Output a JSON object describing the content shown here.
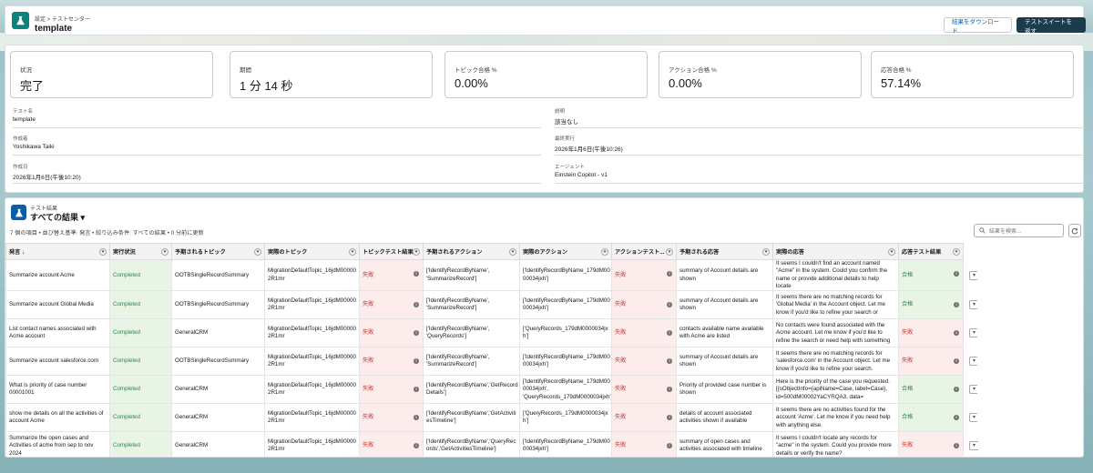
{
  "header": {
    "breadcrumb": "設定 > テストセンター",
    "title": "template",
    "download_label": "結果をダウンロード",
    "back_label": "テストスイートを返す"
  },
  "cards": [
    {
      "label": "状況",
      "value": "完了"
    },
    {
      "label": "期間",
      "value": "1 分 14 秒"
    },
    {
      "label": "トピック合格 %",
      "value": "0.00%"
    },
    {
      "label": "アクション合格 %",
      "value": "0.00%"
    },
    {
      "label": "応答合格 %",
      "value": "57.14%"
    }
  ],
  "details": {
    "test_name_label": "テスト名",
    "test_name": "template",
    "desc_label": "説明",
    "desc": "該当なし",
    "creator_label": "作成者",
    "creator": "Yoshikawa Taiki",
    "last_run_label": "最終実行",
    "last_run": "2026年1月6日(午後10:26)",
    "created_label": "作成日",
    "created": "2026年1月6日(午後10:20)",
    "agent_label": "エージェント",
    "agent": "Einstein Copilot - v1"
  },
  "results": {
    "subtitle": "テスト結果",
    "title": "すべての結果 ▾",
    "meta": "7 個の項目 • 並び替え基準: 発言 • 絞り込み条件: すべての結果 • 0 分前に更新",
    "search_placeholder": "結果を検索...",
    "columns": [
      "発言 ↓",
      "実行状況",
      "予期されるトピック",
      "実際のトピック",
      "トピックテスト結果",
      "予期されるアクション",
      "実際のアクション",
      "アクションテスト...",
      "予期される応答",
      "実際の応答",
      "応答テスト結果"
    ],
    "rows": [
      {
        "utterance": "Summarize account Acme",
        "status": "Completed",
        "exp_topic": "OOTBSingleRecordSummary",
        "act_topic": "MigrationDefaultTopic_16jdM00000 2R1mr",
        "topic_result": "失敗",
        "exp_action": "['IdentifyRecordByName', 'SummarizeRecord']",
        "act_action": "['IdentifyRecordByName_179dM00 00034jxh']",
        "action_result": "失敗",
        "exp_resp": "summary of Account details are shown",
        "act_resp": "It seems I couldn't find an account named \"Acme\" in the system. Could you confirm the name or provide additional details to help locate",
        "resp_result": "合格"
      },
      {
        "utterance": "Summarize account Global Media",
        "status": "Completed",
        "exp_topic": "OOTBSingleRecordSummary",
        "act_topic": "MigrationDefaultTopic_16jdM00000 2R1mr",
        "topic_result": "失敗",
        "exp_action": "['IdentifyRecordByName', 'SummarizeRecord']",
        "act_action": "['IdentifyRecordByName_179dM00 00034jxh']",
        "action_result": "失敗",
        "exp_resp": "summary of Account details are shown",
        "act_resp": "It seems there are no matching records for 'Global Media' in the Account object. Let me know if you'd like to refine your search or",
        "resp_result": "合格"
      },
      {
        "utterance": "List contact names associated with Acme account",
        "status": "Completed",
        "exp_topic": "GeneralCRM",
        "act_topic": "MigrationDefaultTopic_16jdM00000 2R1mr",
        "topic_result": "失敗",
        "exp_action": "['IdentifyRecordByName', 'QueryRecords']",
        "act_action": "['QueryRecords_179dM0000034jx h']",
        "action_result": "失敗",
        "exp_resp": "contacts available name available with Acme are listed",
        "act_resp": "No contacts were found associated with the Acme account. Let me know if you'd like to refine the search or need help with something",
        "resp_result": "失敗"
      },
      {
        "utterance": "Summarize account salesforce.com",
        "status": "Completed",
        "exp_topic": "OOTBSingleRecordSummary",
        "act_topic": "MigrationDefaultTopic_16jdM00000 2R1mr",
        "topic_result": "失敗",
        "exp_action": "['IdentifyRecordByName', 'SummarizeRecord']",
        "act_action": "['IdentifyRecordByName_179dM00 00034jxh']",
        "action_result": "失敗",
        "exp_resp": "summary of Account details are shown",
        "act_resp": "It seems there are no matching records for 'salesforce.com' in the Account object. Let me know if you'd like to refine your search.",
        "resp_result": "失敗"
      },
      {
        "utterance": "What is priority of case number 00001001",
        "status": "Completed",
        "exp_topic": "GeneralCRM",
        "act_topic": "MigrationDefaultTopic_16jdM00000 2R1mr",
        "topic_result": "失敗",
        "exp_action": "['IdentifyRecordByName','GetRecord Details']",
        "act_action": "['IdentifyRecordByName_179dM00 00034jxh', 'QueryRecords_179dM0000034jxh']",
        "action_result": "失敗",
        "exp_resp": "Priority of provided case number is shown",
        "act_resp": "Here is the priority of the case you requested. [{sObjectInfo={apiName=Case, label=Case}, id=500dM00002YaCYRQA3, data=",
        "resp_result": "合格"
      },
      {
        "utterance": "show me details on all the activities of account Acme",
        "status": "Completed",
        "exp_topic": "GeneralCRM",
        "act_topic": "MigrationDefaultTopic_16jdM00000 2R1mr",
        "topic_result": "失敗",
        "exp_action": "['IdentifyRecordByName','GetActiviti esTimeline']",
        "act_action": "['QueryRecords_179dM0000034jx h']",
        "action_result": "失敗",
        "exp_resp": "details of account associated activities shown if available",
        "act_resp": "It seems there are no activities found for the account 'Acme'. Let me know if you need help with anything else.",
        "resp_result": "合格"
      },
      {
        "utterance": "Summarize the open cases and Activities of acme from sep to nov 2024",
        "status": "Completed",
        "exp_topic": "GeneralCRM",
        "act_topic": "MigrationDefaultTopic_16jdM00000 2R1mr",
        "topic_result": "失敗",
        "exp_action": "['IdentifyRecordByName','QueryRec ords','GetActivitiesTimeline']",
        "act_action": "['IdentifyRecordByName_179dM00 00034jxh']",
        "action_result": "失敗",
        "exp_resp": "summary of open cases and activities associated with timeline",
        "act_resp": "It seems I couldn't locate any records for \"acme\" in the system. Could you provide more details or verify the name?",
        "resp_result": "失敗"
      }
    ]
  }
}
